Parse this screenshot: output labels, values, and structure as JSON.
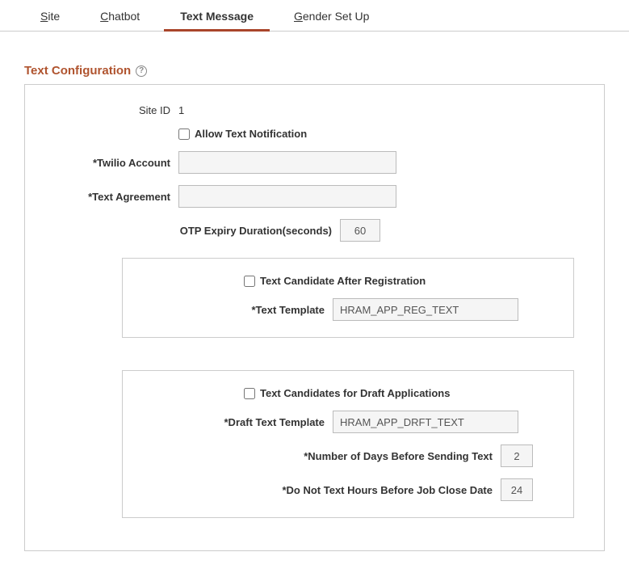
{
  "tabs": {
    "site": "Site",
    "chatbot": "Chatbot",
    "text_message": "Text Message",
    "gender_setup": "Gender Set Up"
  },
  "section": {
    "title": "Text Configuration"
  },
  "fields": {
    "site_id_label": "Site ID",
    "site_id_value": "1",
    "allow_text_notification": "Allow Text Notification",
    "twilio_account_label": "*Twilio Account",
    "twilio_account_value": "",
    "text_agreement_label": "*Text Agreement",
    "text_agreement_value": "",
    "otp_expiry_label": "OTP Expiry Duration(seconds)",
    "otp_expiry_value": "60"
  },
  "box1": {
    "checkbox_label": "Text Candidate After Registration",
    "text_template_label": "*Text Template",
    "text_template_value": "HRAM_APP_REG_TEXT"
  },
  "box2": {
    "checkbox_label": "Text Candidates for Draft Applications",
    "draft_template_label": "*Draft Text Template",
    "draft_template_value": "HRAM_APP_DRFT_TEXT",
    "days_before_label": "*Number of Days Before Sending Text",
    "days_before_value": "2",
    "hours_before_label": "*Do Not Text Hours Before Job Close Date",
    "hours_before_value": "24"
  }
}
